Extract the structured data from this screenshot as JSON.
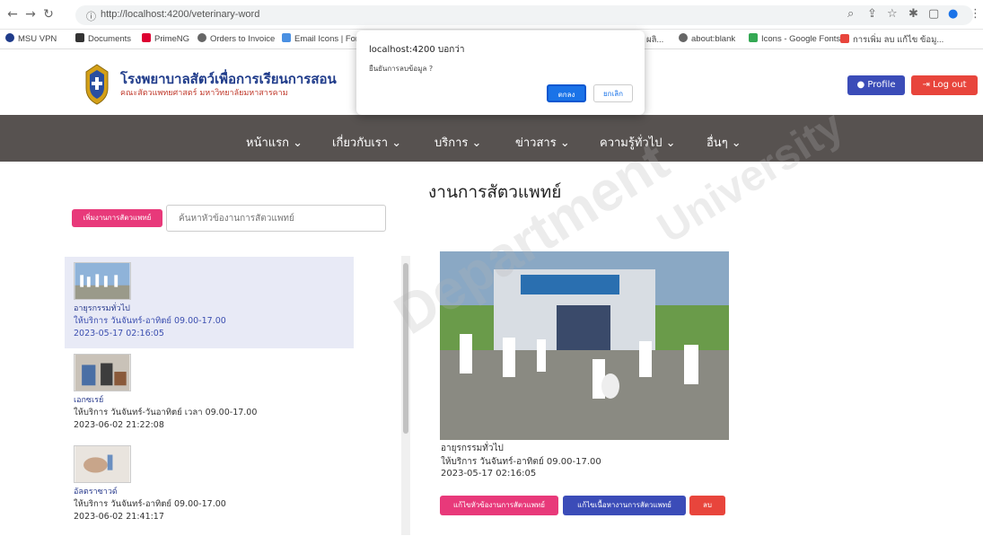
{
  "browser": {
    "url": "http://localhost:4200/veterinary-word",
    "bookmarks": [
      "MSU VPN",
      "Documents",
      "PrimeNG",
      "Orders to Invoice",
      "Email Icons | Font",
      "ผลิ...",
      "about:blank",
      "Icons - Google Fonts",
      "การเพิ่ม ลบ แก้ไข ข้อมู..."
    ]
  },
  "dialog": {
    "title": "localhost:4200 บอกว่า",
    "message": "ยืนยันการลบข้อมูล ?",
    "ok": "ตกลง",
    "cancel": "ยกเลิก"
  },
  "header": {
    "title": "โรงพยาบาลสัตว์เพื่อการเรียนการสอน",
    "subtitle": "คณะสัตวแพทยศาสตร์ มหาวิทยาลัยมหาสารคาม",
    "profile": "Profile",
    "logout": "Log out"
  },
  "nav": [
    "หน้าแรก ⌄",
    "เกี่ยวกับเรา ⌄",
    "บริการ ⌄",
    "ข่าวสาร ⌄",
    "ความรู้ทั่วไป ⌄",
    "อื่นๆ ⌄"
  ],
  "page": {
    "title": "งานการสัตวแพทย์",
    "add_button": "เพิ่มงานการสัตวแพทย์",
    "search_placeholder": "ค้นหาหัวข้องานการสัตวแพทย์"
  },
  "list": [
    {
      "title": "อายุรกรรมทั่วไป",
      "desc": "ให้บริการ วันจันทร์-อาทิตย์ 09.00-17.00",
      "date": "2023-05-17 02:16:05"
    },
    {
      "title": "เอกซเรย์",
      "desc": "ให้บริการ วันจันทร์-วันอาทิตย์ เวลา 09.00-17.00",
      "date": "2023-06-02 21:22:08"
    },
    {
      "title": "อัลตราซาวด์",
      "desc": "ให้บริการ วันจันทร์-อาทิตย์ 09.00-17.00",
      "date": "2023-06-02 21:41:17"
    }
  ],
  "detail": {
    "title": "อายุรกรรมทั่วไป",
    "desc": "ให้บริการ วันจันทร์-อาทิตย์ 09.00-17.00",
    "date": "2023-05-17 02:16:05",
    "edit_title": "แก้ไขหัวข้องานการสัตวแพทย์",
    "edit_content": "แก้ไขเนื้อหางานการสัตวแพทย์",
    "delete": "ลบ"
  },
  "colors": {
    "navbar": "#575250",
    "primary": "#3b4cb8",
    "danger": "#e8453c",
    "pink": "#e8397a"
  }
}
